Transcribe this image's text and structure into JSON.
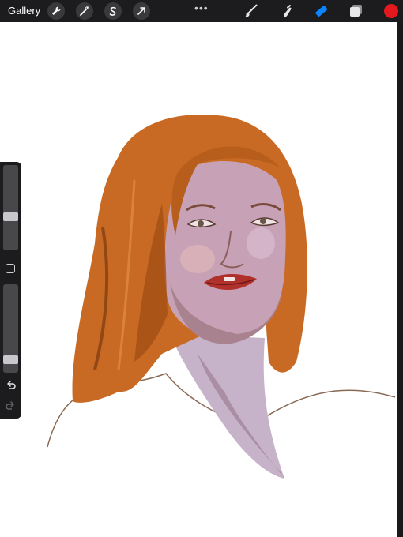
{
  "toolbar": {
    "gallery_label": "Gallery",
    "left_tools": [
      "wrench-icon",
      "magic-wand-icon",
      "selection-icon",
      "transform-arrow-icon"
    ],
    "more_label": "•••",
    "right_tools": [
      "brush-icon",
      "smudge-icon",
      "eraser-icon",
      "layers-icon"
    ],
    "active_tool": "eraser-icon",
    "current_color": "#e3191f"
  },
  "sidebar": {
    "brush_size_level": 0.38,
    "opacity_level": 0.11
  },
  "colors": {
    "accent": "#0a84ff",
    "chrome": "#1c1c1e",
    "hair": "#c86a24",
    "skin": "#c7a2b6",
    "lips": "#b0302c"
  }
}
